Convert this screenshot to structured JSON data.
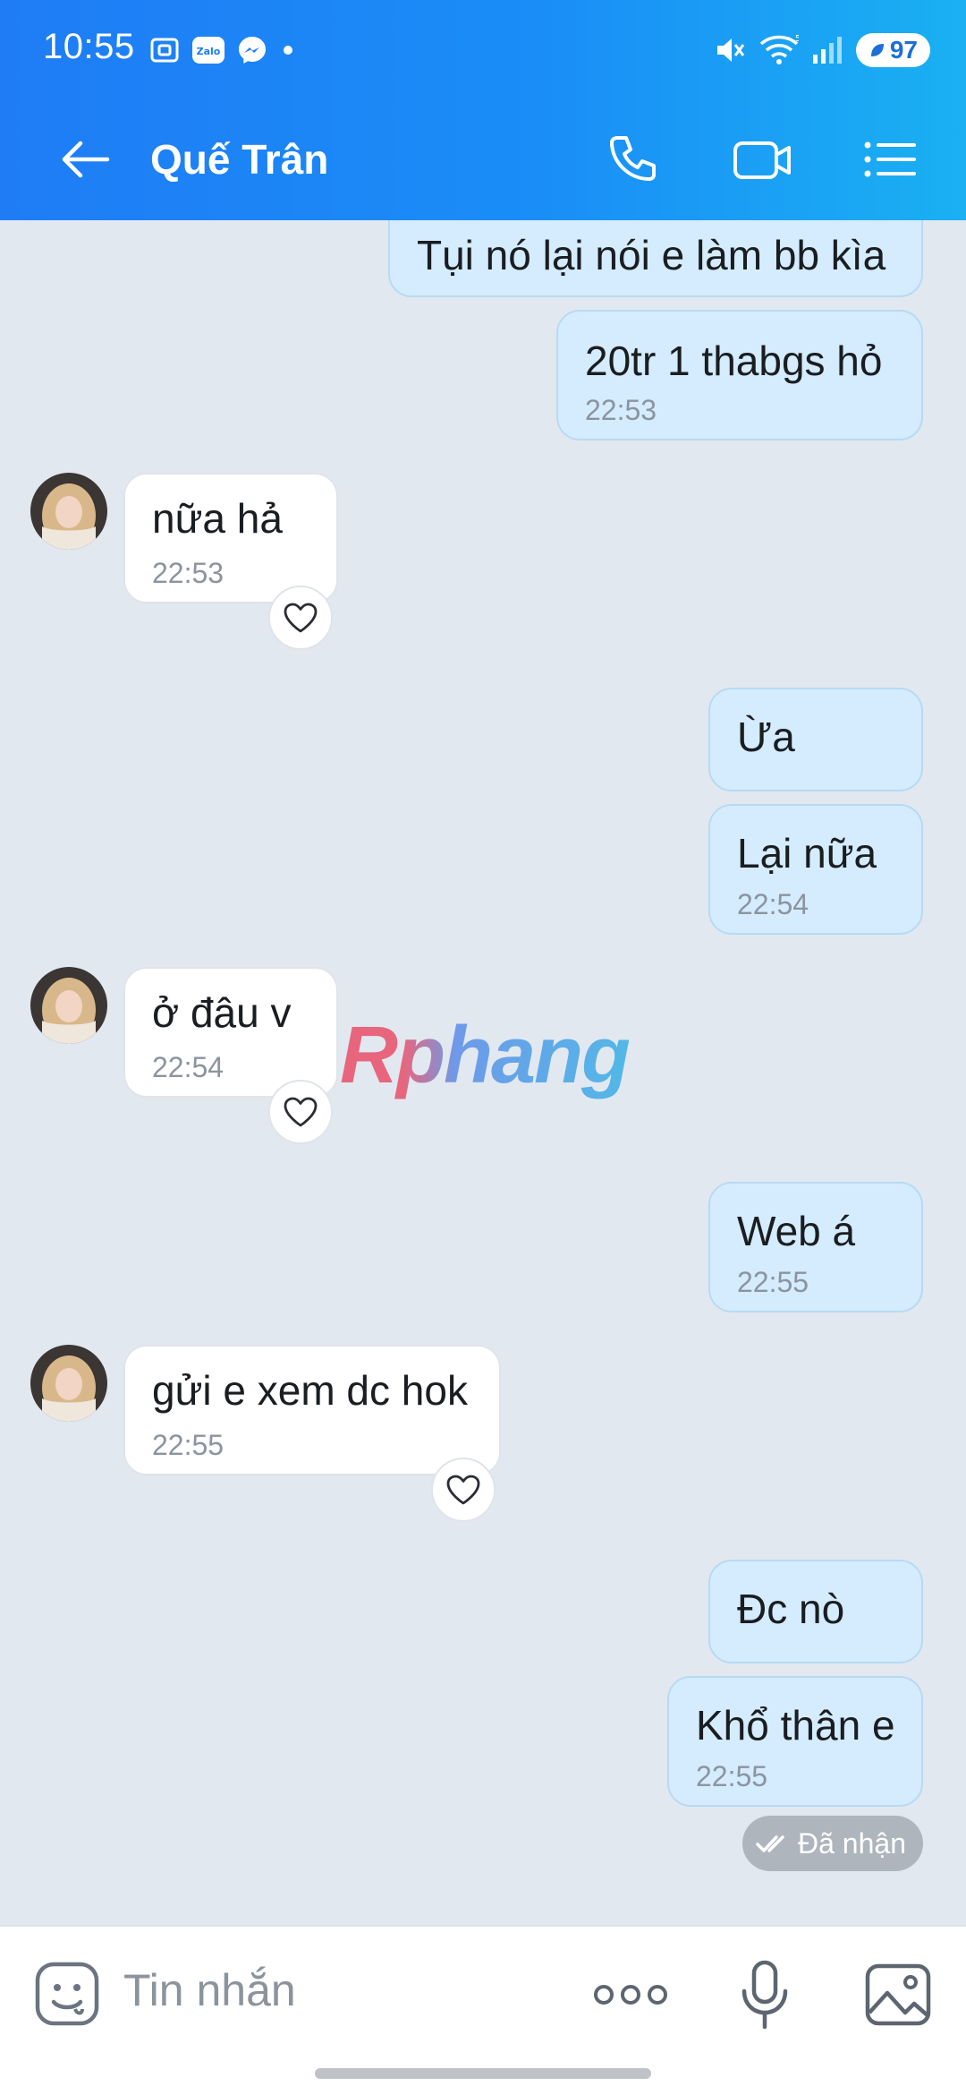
{
  "status_bar": {
    "time": "10:55",
    "battery": "97",
    "icons": [
      "screenshot-icon",
      "zalo-icon",
      "messenger-icon",
      "dot-icon",
      "mute-icon",
      "wifi-icon",
      "signal-icon",
      "battery-icon"
    ]
  },
  "header": {
    "contact_name": "Quế Trân",
    "icons": [
      "back-arrow-icon",
      "phone-icon",
      "video-call-icon",
      "menu-list-icon"
    ]
  },
  "messages": [
    {
      "id": "m1",
      "direction": "out",
      "text": "Tụi nó lại nói e làm bb kìa",
      "time": ""
    },
    {
      "id": "m2",
      "direction": "out",
      "text": "20tr 1 thabgs hỏ",
      "time": "22:53"
    },
    {
      "id": "m3",
      "direction": "in",
      "text": "nữa hả",
      "time": "22:53"
    },
    {
      "id": "m4",
      "direction": "out",
      "text": "Ừa",
      "time": ""
    },
    {
      "id": "m5",
      "direction": "out",
      "text": "Lại nữa",
      "time": "22:54"
    },
    {
      "id": "m6",
      "direction": "in",
      "text": "ở đâu v",
      "time": "22:54"
    },
    {
      "id": "m7",
      "direction": "out",
      "text": "Web á",
      "time": "22:55"
    },
    {
      "id": "m8",
      "direction": "in",
      "text": "gửi e xem dc hok",
      "time": "22:55"
    },
    {
      "id": "m9",
      "direction": "out",
      "text": "Đc nò",
      "time": ""
    },
    {
      "id": "m10",
      "direction": "out",
      "text": "Khổ thân e",
      "time": "22:55"
    }
  ],
  "delivery_status": "Đã nhận",
  "watermark": "Rphang",
  "composer": {
    "placeholder": "Tin nhắn",
    "icons": [
      "emoji-sticker-icon",
      "more-dots-icon",
      "microphone-icon",
      "image-gallery-icon"
    ]
  },
  "colors": {
    "header_gradient_start": "#1f7cf5",
    "header_gradient_end": "#1ab0f2",
    "chat_background": "#e2e8f0",
    "outgoing_bubble": "#d4ecfd",
    "incoming_bubble": "#ffffff"
  }
}
